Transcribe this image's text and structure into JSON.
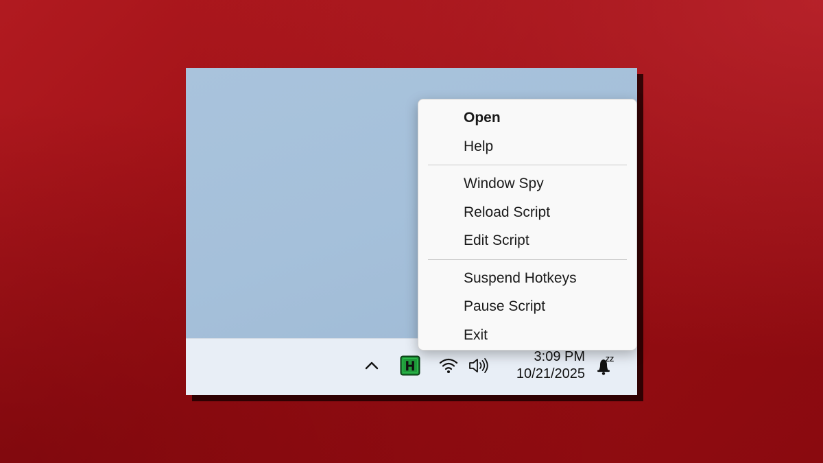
{
  "context_menu": {
    "items": [
      {
        "label": "Open",
        "bold": true
      },
      {
        "label": "Help"
      },
      {
        "separator": true
      },
      {
        "label": "Window Spy"
      },
      {
        "label": "Reload Script"
      },
      {
        "label": "Edit Script"
      },
      {
        "separator": true
      },
      {
        "label": "Suspend Hotkeys"
      },
      {
        "label": "Pause Script"
      },
      {
        "label": "Exit"
      }
    ]
  },
  "taskbar": {
    "clock": {
      "time": "3:09 PM",
      "date": "10/21/2025"
    },
    "tray_icons": [
      "chevron-up-icon",
      "autohotkey-icon",
      "wifi-icon",
      "volume-icon",
      "bell-snooze-icon"
    ],
    "ahk_icon_letter": "H",
    "bell_badge": "ZZ"
  },
  "colors": {
    "background_red": "#9a0f14",
    "desktop_blue": "#a5c0da",
    "taskbar": "#e8eef6",
    "menu_bg": "#f9f9f9",
    "ahk_green": "#1f9a3a"
  }
}
